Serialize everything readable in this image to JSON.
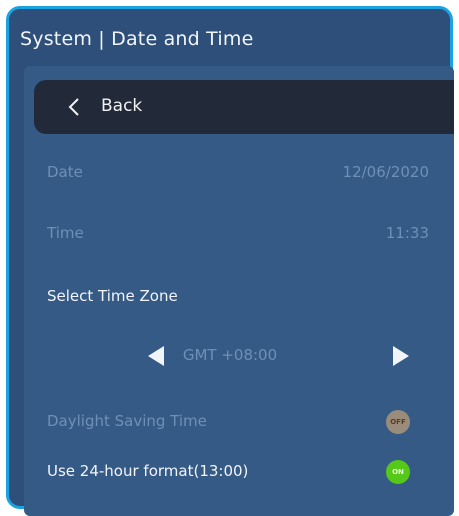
{
  "header": {
    "title": "System | Date and Time"
  },
  "back_bar": {
    "label": "Back",
    "icon": "chevron-left-icon"
  },
  "settings": {
    "date_label": "Date",
    "date_value": "12/06/2020",
    "time_label": "Time",
    "time_value": "11:33",
    "timezone_heading": "Select Time Zone",
    "timezone_value": "GMT +08:00",
    "timezone_prev_icon": "triangle-left-icon",
    "timezone_next_icon": "triangle-right-icon",
    "dst_label": "Daylight Saving Time",
    "dst_toggle": "OFF",
    "format24_label": "Use 24-hour format(13:00)",
    "format24_toggle": "ON"
  },
  "colors": {
    "frame_border": "#1aa3e0",
    "background": "#2d4f7a",
    "back_bar": "#222a39",
    "toggle_on": "#56c817",
    "toggle_off": "#9a8c7a"
  }
}
